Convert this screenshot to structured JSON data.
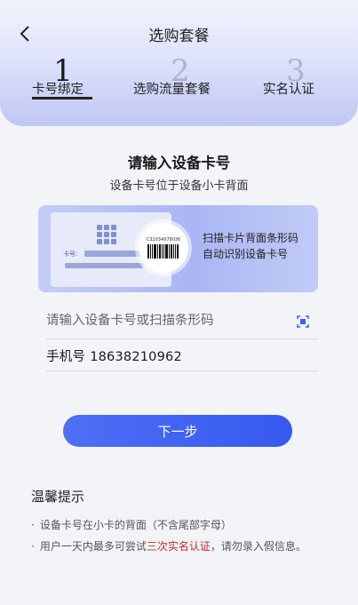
{
  "header": {
    "title": "选购套餐"
  },
  "steps": [
    {
      "num": "1",
      "label": "卡号绑定"
    },
    {
      "num": "2",
      "label": "选购流量套餐"
    },
    {
      "num": "3",
      "label": "实名认证"
    }
  ],
  "main": {
    "headline": "请输入设备卡号",
    "subline": "设备卡号位于设备小卡背面",
    "scan_card": {
      "card_number_label": "卡号:",
      "barcode_text": "C32034978036",
      "line1": "扫描卡片背面条形码",
      "line2": "自动识别设备卡号"
    },
    "card_input": {
      "placeholder": "请输入设备卡号或扫描条形码",
      "value": ""
    },
    "phone_label": "手机号",
    "phone_value": "18638210962",
    "next_label": "下一步"
  },
  "tips": {
    "title": "温馨提示",
    "bullet": "·",
    "tip1": "设备卡号在小卡的背面（不含尾部字母）",
    "tip2_prefix": "用户一天内最多可尝试",
    "tip2_highlight": "三次实名认证",
    "tip2_suffix": "，请勿录入假信息。"
  },
  "colors": {
    "accent": "#3d5ff2",
    "highlight": "#c42a2a",
    "header_gradient_end": "#bfc7f5"
  }
}
